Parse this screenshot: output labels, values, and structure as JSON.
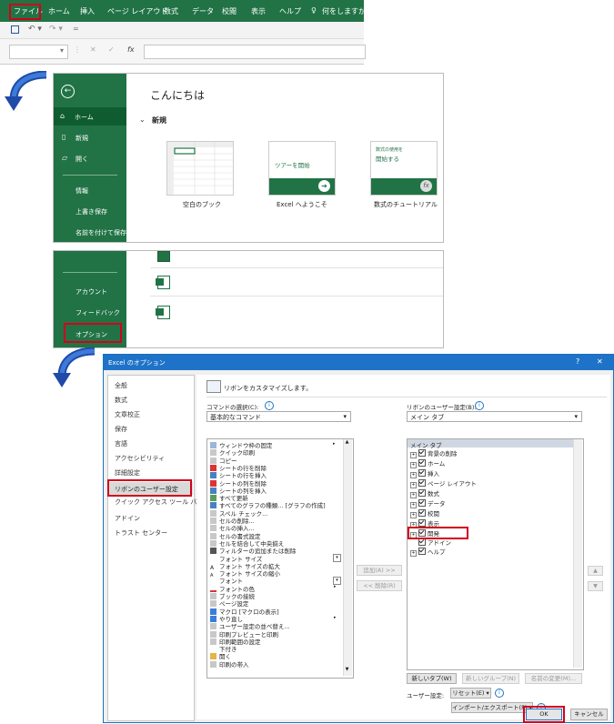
{
  "ribbon": {
    "tabs": [
      "ファイル",
      "ホーム",
      "挿入",
      "ページ レイアウト",
      "数式",
      "データ",
      "校閲",
      "表示",
      "ヘルプ"
    ],
    "tell_me": "何をしますか"
  },
  "formula_bar": {
    "fx": "fx"
  },
  "backstage": {
    "greeting": "こんにちは",
    "nav": [
      "ホーム",
      "新規",
      "開く",
      "情報",
      "上書き保存",
      "名前を付けて保存"
    ],
    "new_section": "新規",
    "templates": [
      {
        "label": "空白のブック"
      },
      {
        "label": "Excel へようこそ",
        "inner": "ツアーを開始"
      },
      {
        "label": "数式のチュートリアル",
        "inner_small": "数式の使用を",
        "inner": "開始する"
      }
    ],
    "nav_bottom": [
      "アカウント",
      "フィードバック",
      "オプション"
    ]
  },
  "dialog": {
    "title": "Excel のオプション",
    "help": "?",
    "close": "✕",
    "nav": [
      "全般",
      "数式",
      "文章校正",
      "保存",
      "言語",
      "アクセシビリティ",
      "詳細設定",
      "リボンのユーザー設定",
      "クイック アクセス ツール バー",
      "アドイン",
      "トラスト センター"
    ],
    "heading": "リボンをカスタマイズします。",
    "commands_label": "コマンドの選択(C):",
    "commands_value": "基本的なコマンド",
    "ribbon_label": "リボンのユーザー設定(B):",
    "ribbon_value": "メイン タブ",
    "commands": [
      "ウィンドウ枠の固定",
      "クイック印刷",
      "コピー",
      "シートの行を削除",
      "シートの行を挿入",
      "シートの列を削除",
      "シートの列を挿入",
      "すべて更新",
      "すべてのグラフの種類... [グラフの作成]",
      "スペル チェック...",
      "セルの削除...",
      "セルの挿入...",
      "セルの書式設定",
      "セルを結合して中央揃え",
      "フィルターの追加または削除",
      "フォント サイズ",
      "フォント サイズの拡大",
      "フォント サイズの縮小",
      "フォント",
      "フォントの色",
      "ブックの接続",
      "ページ設定",
      "マクロ [マクロの表示]",
      "やり直し",
      "ユーザー設定の並べ替え...",
      "印刷プレビューと印刷",
      "印刷範囲の設定",
      "下付き",
      "開く",
      "印刷の帯入"
    ],
    "add": "追加(A) >>",
    "remove": "<< 削除(R)",
    "tabs_header": "メイン タブ",
    "tabs": [
      "背景の削除",
      "ホーム",
      "挿入",
      "ページ レイアウト",
      "数式",
      "データ",
      "校閲",
      "表示",
      "開発",
      "アドイン",
      "ヘルプ"
    ],
    "new_tab": "新しいタブ(W)",
    "new_group": "新しいグループ(N)",
    "rename": "名前の変更(M)...",
    "user_settings": "ユーザー設定:",
    "reset": "リセット(E) ▾",
    "import_export": "インポート/エクスポート(P) ▾",
    "ok": "OK",
    "cancel": "キャンセル"
  },
  "colors": {
    "excel_green": "#217346",
    "highlight_red": "#d0021b",
    "dialog_blue": "#1e73c8"
  }
}
